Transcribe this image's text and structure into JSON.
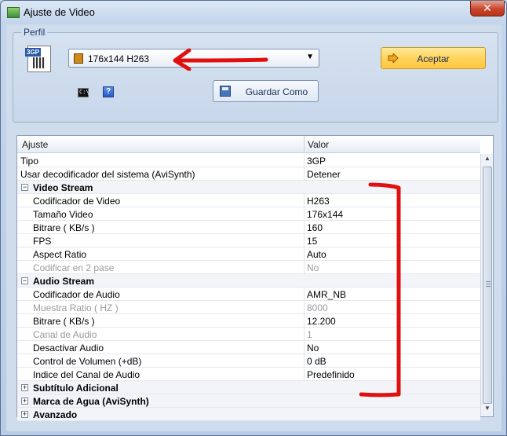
{
  "window": {
    "title": "Ajuste de Video",
    "close_glyph": "✕"
  },
  "profile_group": {
    "label": "Perfil",
    "file_icon_tag": "3GP",
    "selected_profile": "176x144 H263",
    "dropdown_arrow": "▼",
    "accept_label": "Aceptar",
    "save_as_label": "Guardar Como",
    "cmd_icon_text": "C:\\",
    "help_icon_text": "?"
  },
  "grid": {
    "col_setting": "Ajuste",
    "col_value": "Valor",
    "rows": [
      {
        "type": "prop",
        "indent": 0,
        "name": "Tipo",
        "value": "3GP",
        "disabled": false
      },
      {
        "type": "prop",
        "indent": 0,
        "name": "Usar decodificador del sistema (AviSynth)",
        "value": "Detener",
        "disabled": false
      },
      {
        "type": "cat",
        "name": "Video Stream",
        "expanded": true
      },
      {
        "type": "prop",
        "indent": 1,
        "name": "Codificador de Video",
        "value": "H263",
        "disabled": false
      },
      {
        "type": "prop",
        "indent": 1,
        "name": "Tamaño Video",
        "value": "176x144",
        "disabled": false
      },
      {
        "type": "prop",
        "indent": 1,
        "name": "Bitrare ( KB/s )",
        "value": "160",
        "disabled": false
      },
      {
        "type": "prop",
        "indent": 1,
        "name": "FPS",
        "value": "15",
        "disabled": false
      },
      {
        "type": "prop",
        "indent": 1,
        "name": "Aspect Ratio",
        "value": "Auto",
        "disabled": false
      },
      {
        "type": "prop",
        "indent": 1,
        "name": "Codificar en 2 pase",
        "value": "No",
        "disabled": true
      },
      {
        "type": "cat",
        "name": "Audio Stream",
        "expanded": true
      },
      {
        "type": "prop",
        "indent": 1,
        "name": "Codificador de Audio",
        "value": "AMR_NB",
        "disabled": false
      },
      {
        "type": "prop",
        "indent": 1,
        "name": "Muestra Ratio ( HZ )",
        "value": "8000",
        "disabled": true
      },
      {
        "type": "prop",
        "indent": 1,
        "name": "Bitrare ( KB/s )",
        "value": "12.200",
        "disabled": false
      },
      {
        "type": "prop",
        "indent": 1,
        "name": "Canal de Audio",
        "value": "1",
        "disabled": true
      },
      {
        "type": "prop",
        "indent": 1,
        "name": "Desactivar Audio",
        "value": "No",
        "disabled": false
      },
      {
        "type": "prop",
        "indent": 1,
        "name": "Control de Volumen (+dB)",
        "value": "0 dB",
        "disabled": false
      },
      {
        "type": "prop",
        "indent": 1,
        "name": "Indice del Canal de Audio",
        "value": "Predefinido",
        "disabled": false
      },
      {
        "type": "cat",
        "name": "Subtítulo Adicional",
        "expanded": false
      },
      {
        "type": "cat",
        "name": "Marca de Agua (AviSynth)",
        "expanded": false
      },
      {
        "type": "cat",
        "name": "Avanzado",
        "expanded": false
      }
    ],
    "scroll_up_glyph": "▲",
    "scroll_down_glyph": "▼"
  },
  "colors": {
    "annotation_red": "#e01010",
    "accept_button": "#ffd35b",
    "window_bg": "#cfdcec"
  },
  "icons": [
    "window-icon",
    "close-icon",
    "3gp-file-icon",
    "film-icon",
    "accept-arrow-icon",
    "cmd-icon",
    "help-icon",
    "save-disk-icon"
  ]
}
